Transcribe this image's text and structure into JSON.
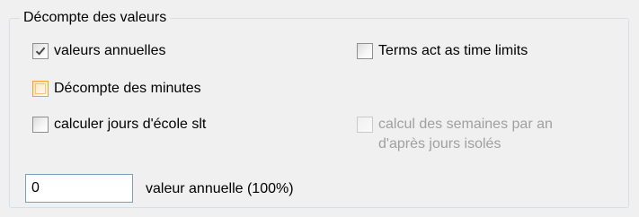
{
  "group": {
    "title": "Décompte des valeurs"
  },
  "checkboxes": {
    "valeurs_annuelles": {
      "label": "valeurs annuelles",
      "checked": true,
      "state": "normal"
    },
    "decompte_minutes": {
      "label": "Décompte des minutes",
      "checked": false,
      "state": "hover"
    },
    "calculer_jours": {
      "label": "calculer jours d'école slt",
      "checked": false,
      "state": "normal"
    },
    "terms_time_limits": {
      "label": "Terms act as time limits",
      "checked": false,
      "state": "normal"
    },
    "calcul_semaines": {
      "label_line1": "calcul des semaines par an",
      "label_line2": "d'après jours isolés",
      "checked": false,
      "state": "disabled"
    }
  },
  "annual_value": {
    "value": "0",
    "label": "valeur annuelle (100%)"
  },
  "colors": {
    "background": "#f0f0f0",
    "hover_border": "#f3a03a",
    "disabled_text": "#a0a0a0",
    "input_border": "#7f9db9"
  }
}
